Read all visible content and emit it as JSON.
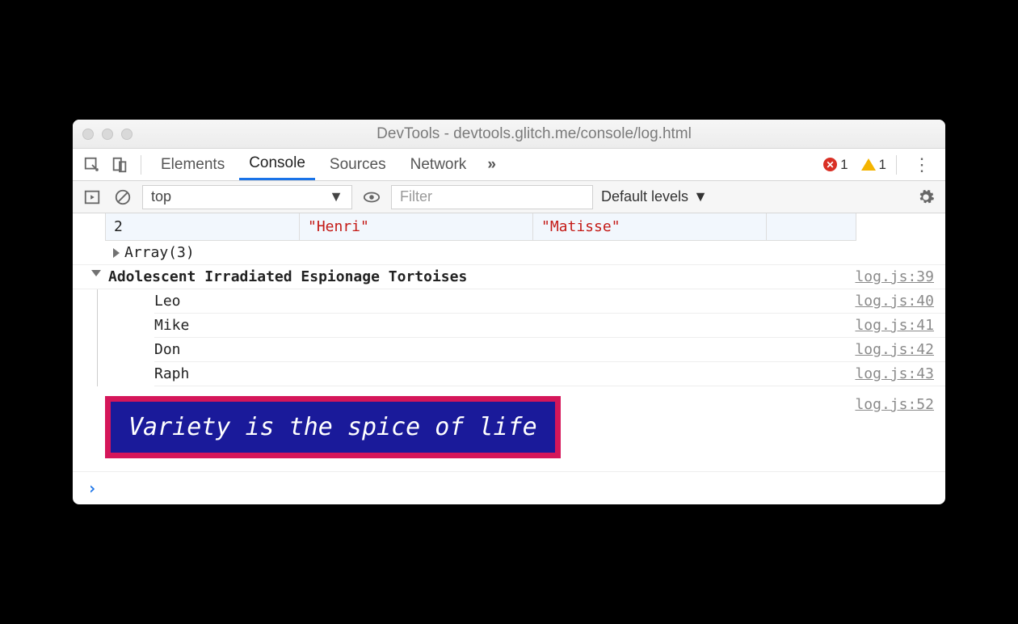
{
  "window": {
    "title": "DevTools - devtools.glitch.me/console/log.html"
  },
  "tabs": {
    "items": [
      "Elements",
      "Console",
      "Sources",
      "Network"
    ],
    "active_index": 1,
    "overflow_glyph": "»",
    "error_count": "1",
    "warn_count": "1"
  },
  "filterbar": {
    "context": "top",
    "filter_placeholder": "Filter",
    "levels_label": "Default levels"
  },
  "table_row": {
    "index": "2",
    "first": "\"Henri\"",
    "last": "\"Matisse\""
  },
  "array_line": "Array(3)",
  "group": {
    "title": "Adolescent Irradiated Espionage Tortoises",
    "source": "log.js:39",
    "items": [
      {
        "msg": "Leo",
        "src": "log.js:40"
      },
      {
        "msg": "Mike",
        "src": "log.js:41"
      },
      {
        "msg": "Don",
        "src": "log.js:42"
      },
      {
        "msg": "Raph",
        "src": "log.js:43"
      }
    ]
  },
  "styled": {
    "text": "Variety is the spice of life",
    "src": "log.js:52",
    "bg": "#1a1a9a",
    "border": "#d5165a",
    "color": "#ffffff"
  },
  "prompt_glyph": "›"
}
